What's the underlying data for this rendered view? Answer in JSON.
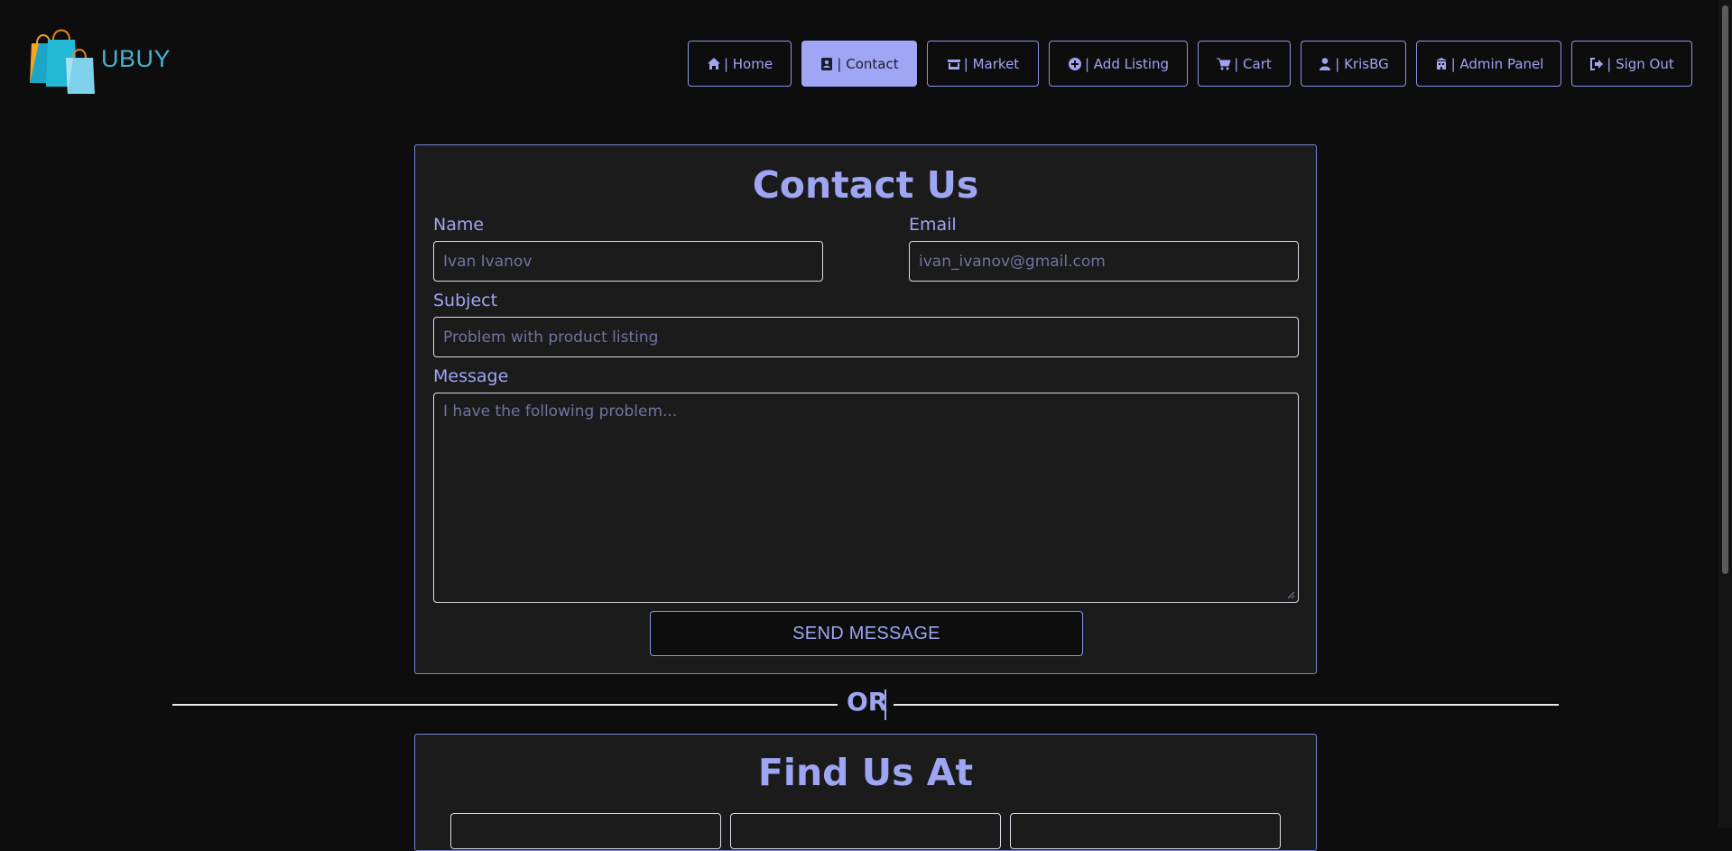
{
  "brand": {
    "name": "UBUY"
  },
  "nav": [
    {
      "icon": "home-icon",
      "label": "| Home",
      "active": false
    },
    {
      "icon": "address-book-icon",
      "label": "| Contact",
      "active": true
    },
    {
      "icon": "store-icon",
      "label": "| Market",
      "active": false
    },
    {
      "icon": "plus-circle-icon",
      "label": "| Add Listing",
      "active": false
    },
    {
      "icon": "cart-icon",
      "label": "| Cart",
      "active": false
    },
    {
      "icon": "user-icon",
      "label": "| KrisBG",
      "active": false
    },
    {
      "icon": "building-icon",
      "label": "| Admin Panel",
      "active": false
    },
    {
      "icon": "sign-out-icon",
      "label": "| Sign Out",
      "active": false
    }
  ],
  "contact": {
    "title": "Contact Us",
    "name_label": "Name",
    "name_placeholder": "Ivan Ivanov",
    "email_label": "Email",
    "email_placeholder": "ivan_ivanov@gmail.com",
    "subject_label": "Subject",
    "subject_placeholder": "Problem with product listing",
    "message_label": "Message",
    "message_placeholder": "I have the following problem...",
    "send_label": "SEND MESSAGE"
  },
  "divider": {
    "text": "OR"
  },
  "find": {
    "title": "Find Us At"
  },
  "colors": {
    "accent": "#9ea6f3",
    "background": "#0d0d0e",
    "card": "#1b1b1c"
  }
}
